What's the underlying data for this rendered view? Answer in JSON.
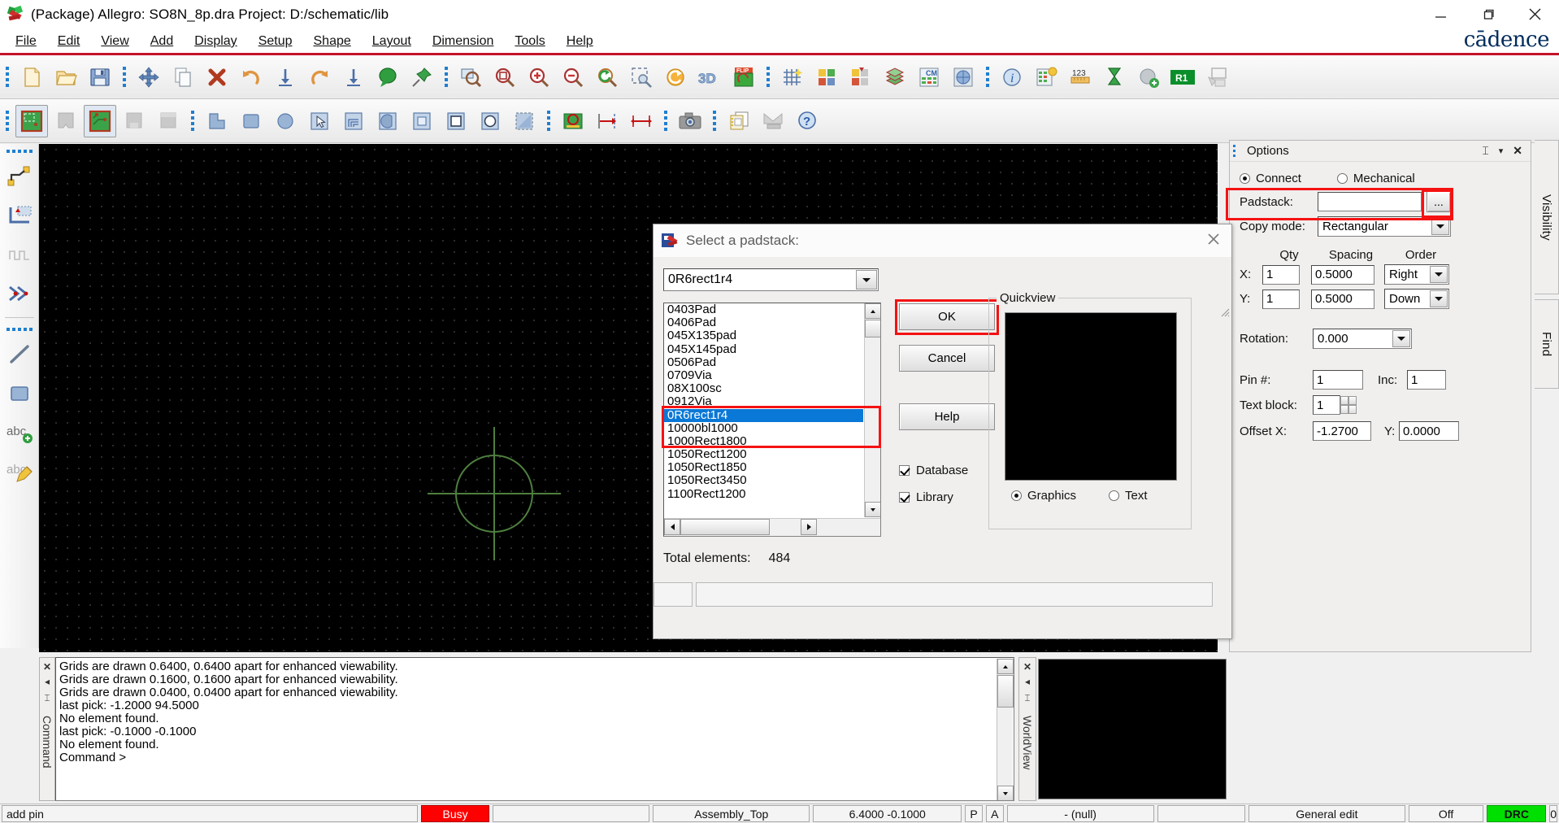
{
  "titlebar": {
    "title": "(Package) Allegro: SO8N_8p.dra  Project: D:/schematic/lib",
    "app_icon": "allegro-icon",
    "minimize": "minimize-icon",
    "maximize": "maximize-icon",
    "close": "close-icon"
  },
  "brand": {
    "logo": "cādence"
  },
  "menubar": {
    "items": [
      {
        "label": "File"
      },
      {
        "label": "Edit"
      },
      {
        "label": "View"
      },
      {
        "label": "Add"
      },
      {
        "label": "Display"
      },
      {
        "label": "Setup"
      },
      {
        "label": "Shape"
      },
      {
        "label": "Layout"
      },
      {
        "label": "Dimension"
      },
      {
        "label": "Tools"
      },
      {
        "label": "Help"
      }
    ]
  },
  "toolbar_row1": {
    "groups": [
      {
        "buttons": [
          {
            "name": "new-file-icon"
          },
          {
            "name": "open-file-icon"
          },
          {
            "name": "save-icon"
          }
        ]
      },
      {
        "buttons": [
          {
            "name": "move-icon"
          },
          {
            "name": "copy-icon"
          },
          {
            "name": "delete-icon"
          },
          {
            "name": "undo-icon"
          },
          {
            "name": "insert-down-icon"
          },
          {
            "name": "redo-icon"
          },
          {
            "name": "extract-down-icon"
          },
          {
            "name": "comment-icon"
          },
          {
            "name": "pin-icon"
          }
        ]
      },
      {
        "buttons": [
          {
            "name": "zoom-fit-icon"
          },
          {
            "name": "zoom-world-icon"
          },
          {
            "name": "zoom-in-icon"
          },
          {
            "name": "zoom-out-icon"
          },
          {
            "name": "zoom-previous-icon"
          },
          {
            "name": "zoom-points-icon"
          },
          {
            "name": "redraw-icon"
          },
          {
            "name": "three-d-view-icon"
          },
          {
            "name": "flip-design-icon"
          }
        ]
      },
      {
        "buttons": [
          {
            "name": "grid-toggle-icon"
          },
          {
            "name": "color-view-icon"
          },
          {
            "name": "subclass-icon"
          },
          {
            "name": "layers-icon"
          },
          {
            "name": "constraint-manager-icon"
          },
          {
            "name": "world-view-icon"
          }
        ]
      },
      {
        "buttons": [
          {
            "name": "show-element-icon"
          },
          {
            "name": "property-icon"
          },
          {
            "name": "measure-icon"
          },
          {
            "name": "timing-icon"
          },
          {
            "name": "add-connect-icon"
          },
          {
            "name": "refdes-r1-icon"
          },
          {
            "name": "display-window-icon"
          }
        ]
      }
    ]
  },
  "toolbar_row2": {
    "groups": [
      {
        "buttons": [
          {
            "name": "board-select-icon"
          },
          {
            "name": "board-disabled-icon"
          },
          {
            "name": "board-route-icon"
          },
          {
            "name": "board-empty1-icon"
          },
          {
            "name": "board-empty2-icon"
          }
        ]
      },
      {
        "buttons": [
          {
            "name": "shape-polygon-icon"
          },
          {
            "name": "shape-rect-icon"
          },
          {
            "name": "shape-circle-icon"
          },
          {
            "name": "shape-select-icon"
          },
          {
            "name": "shape-compose-icon"
          },
          {
            "name": "shape-void-icon"
          },
          {
            "name": "shape-void-rect-icon"
          },
          {
            "name": "shape-void-square-icon"
          },
          {
            "name": "shape-void-circle-icon"
          },
          {
            "name": "shape-void-poly-icon"
          }
        ]
      },
      {
        "buttons": [
          {
            "name": "drc-check-icon"
          },
          {
            "name": "dimension-leader-icon"
          },
          {
            "name": "dimension-linear-icon"
          }
        ]
      },
      {
        "buttons": [
          {
            "name": "screenshot-icon"
          }
        ]
      },
      {
        "buttons": [
          {
            "name": "reports-icon"
          },
          {
            "name": "plot-icon"
          },
          {
            "name": "help-icon"
          }
        ]
      }
    ]
  },
  "left_toolbar": {
    "groups": [
      {
        "buttons": [
          {
            "name": "add-connect-line-icon"
          },
          {
            "name": "slide-icon"
          },
          {
            "name": "delay-tune-icon"
          },
          {
            "name": "custom-smooth-icon"
          }
        ]
      },
      {
        "buttons": [
          {
            "name": "add-line-icon"
          },
          {
            "name": "add-rect-icon"
          },
          {
            "name": "add-text-icon"
          },
          {
            "name": "edit-text-icon"
          }
        ]
      }
    ]
  },
  "canvas": {
    "name": "design-canvas",
    "crosshair": "crosshair-cursor"
  },
  "options": {
    "title": "Options",
    "pin_icon": "pin-icon",
    "menu_icon": "chevron-down-icon",
    "close_icon": "close-icon",
    "mode": {
      "connect": "Connect",
      "mechanical": "Mechanical",
      "selected": "Connect"
    },
    "padstack": {
      "label": "Padstack:",
      "value": "",
      "browse_label": "..."
    },
    "copy_mode": {
      "label": "Copy mode:",
      "value": "Rectangular"
    },
    "table_headers": {
      "qty": "Qty",
      "spacing": "Spacing",
      "order": "Order"
    },
    "rows": [
      {
        "axis": "X:",
        "qty": "1",
        "spacing": "0.5000",
        "order": "Right"
      },
      {
        "axis": "Y:",
        "qty": "1",
        "spacing": "0.5000",
        "order": "Down"
      }
    ],
    "rotation": {
      "label": "Rotation:",
      "value": "0.000"
    },
    "pin_number": {
      "label": "Pin #:",
      "value": "1"
    },
    "inc": {
      "label": "Inc:",
      "value": "1"
    },
    "text_block": {
      "label": "Text block:",
      "value": "1"
    },
    "offset": {
      "label_x": "Offset X:",
      "value_x": "-1.2700",
      "label_y": "Y:",
      "value_y": "0.0000"
    }
  },
  "vtabs": [
    {
      "label": "Visibility"
    },
    {
      "label": "Find"
    }
  ],
  "dialog": {
    "title": "Select a padstack:",
    "title_icon": "padstack-icon",
    "close_icon": "close-icon",
    "filter_value": "0R6rect1r4",
    "list_items": [
      "0403Pad",
      "0406Pad",
      "045X135pad",
      "045X145pad",
      "0506Pad",
      "0709Via",
      "08X100sc",
      "0912Via",
      "0R6rect1r4",
      "10000bl1000",
      "1000Rect1800",
      "1050Rect1200",
      "1050Rect1850",
      "1050Rect3450",
      "1100Rect1200"
    ],
    "selected_item": "0R6rect1r4",
    "buttons": {
      "ok": "OK",
      "cancel": "Cancel",
      "help": "Help"
    },
    "checkboxes": [
      {
        "label": "Database",
        "checked": true
      },
      {
        "label": "Library",
        "checked": true
      }
    ],
    "quickview": {
      "title": "Quickview",
      "preview": "black-preview",
      "modes": [
        {
          "label": "Graphics",
          "selected": true
        },
        {
          "label": "Text",
          "selected": false
        }
      ]
    },
    "total_elements_label": "Total elements:",
    "total_elements_value": "484"
  },
  "console": {
    "side_label": "Command",
    "close_icon": "close-icon",
    "collapse_icon": "collapse-icon",
    "pin_icon": "pin-icon",
    "lines": [
      "Grids are drawn 0.6400, 0.6400 apart for enhanced viewability.",
      "Grids are drawn 0.1600, 0.1600 apart for enhanced viewability.",
      "Grids are drawn 0.0400, 0.0400 apart for enhanced viewability.",
      "last pick:  -1.2000  94.5000",
      "No element found.",
      "last pick:  -0.1000  -0.1000",
      "No element found.",
      "Command >"
    ]
  },
  "worldview": {
    "side_label": "WorldView",
    "close_icon": "close-icon",
    "collapse_icon": "collapse-icon",
    "pin_icon": "pin-icon"
  },
  "statusbar": {
    "command": "add pin",
    "busy": "Busy",
    "blank1": "",
    "layer": "Assembly_Top",
    "coords": "6.4000 -0.1000",
    "p_flag": "P",
    "a_flag": "A",
    "net": "- (null)",
    "blank2": "",
    "mode": "General edit",
    "snap": "Off",
    "drc": "DRC",
    "drc_count": "0"
  },
  "colors": {
    "accent_red": "#c4142a",
    "selection_blue": "#0a78d7",
    "highlight_red": "#f51212",
    "drc_green": "#00e000",
    "busy_red": "#ff0000",
    "canvas_black": "#000000",
    "grid_dot": "#3a3a3a",
    "crosshair_green": "#4e7f3e"
  }
}
